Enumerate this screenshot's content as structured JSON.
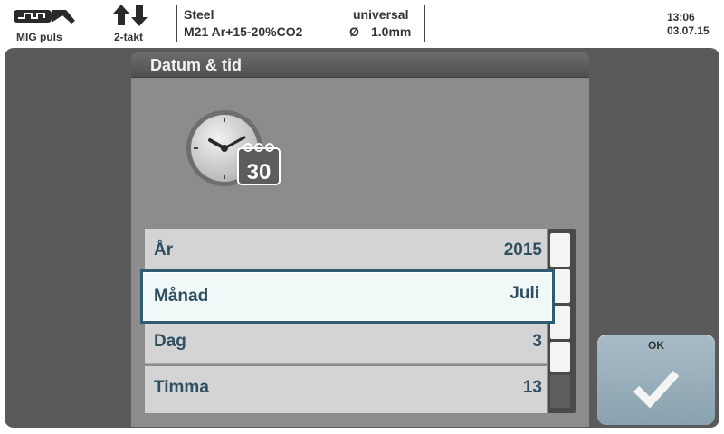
{
  "status": {
    "process_mode": "MIG puls",
    "trigger_mode": "2-takt",
    "material": "Steel",
    "gas": "M21 Ar+15-20%CO2",
    "wire_type": "universal",
    "diameter_symbol": "Ø",
    "diameter": "1.0mm",
    "time": "13:06",
    "date": "03.07.15"
  },
  "dialog": {
    "title": "Datum & tid",
    "icon_day": "30",
    "icon": "clock-calendar-icon",
    "rows": [
      {
        "label": "År",
        "value": "2015"
      },
      {
        "label": "Månad",
        "value": "Juli"
      },
      {
        "label": "Dag",
        "value": "3"
      },
      {
        "label": "Timma",
        "value": "13"
      }
    ],
    "selected_index": 1
  },
  "ok_button": {
    "label": "OK",
    "icon": "checkmark-icon"
  },
  "colors": {
    "accent": "#2e5c72",
    "text": "#2e4e62",
    "workspace": "#5a5a5a",
    "dialog": "#8c8c8c"
  }
}
